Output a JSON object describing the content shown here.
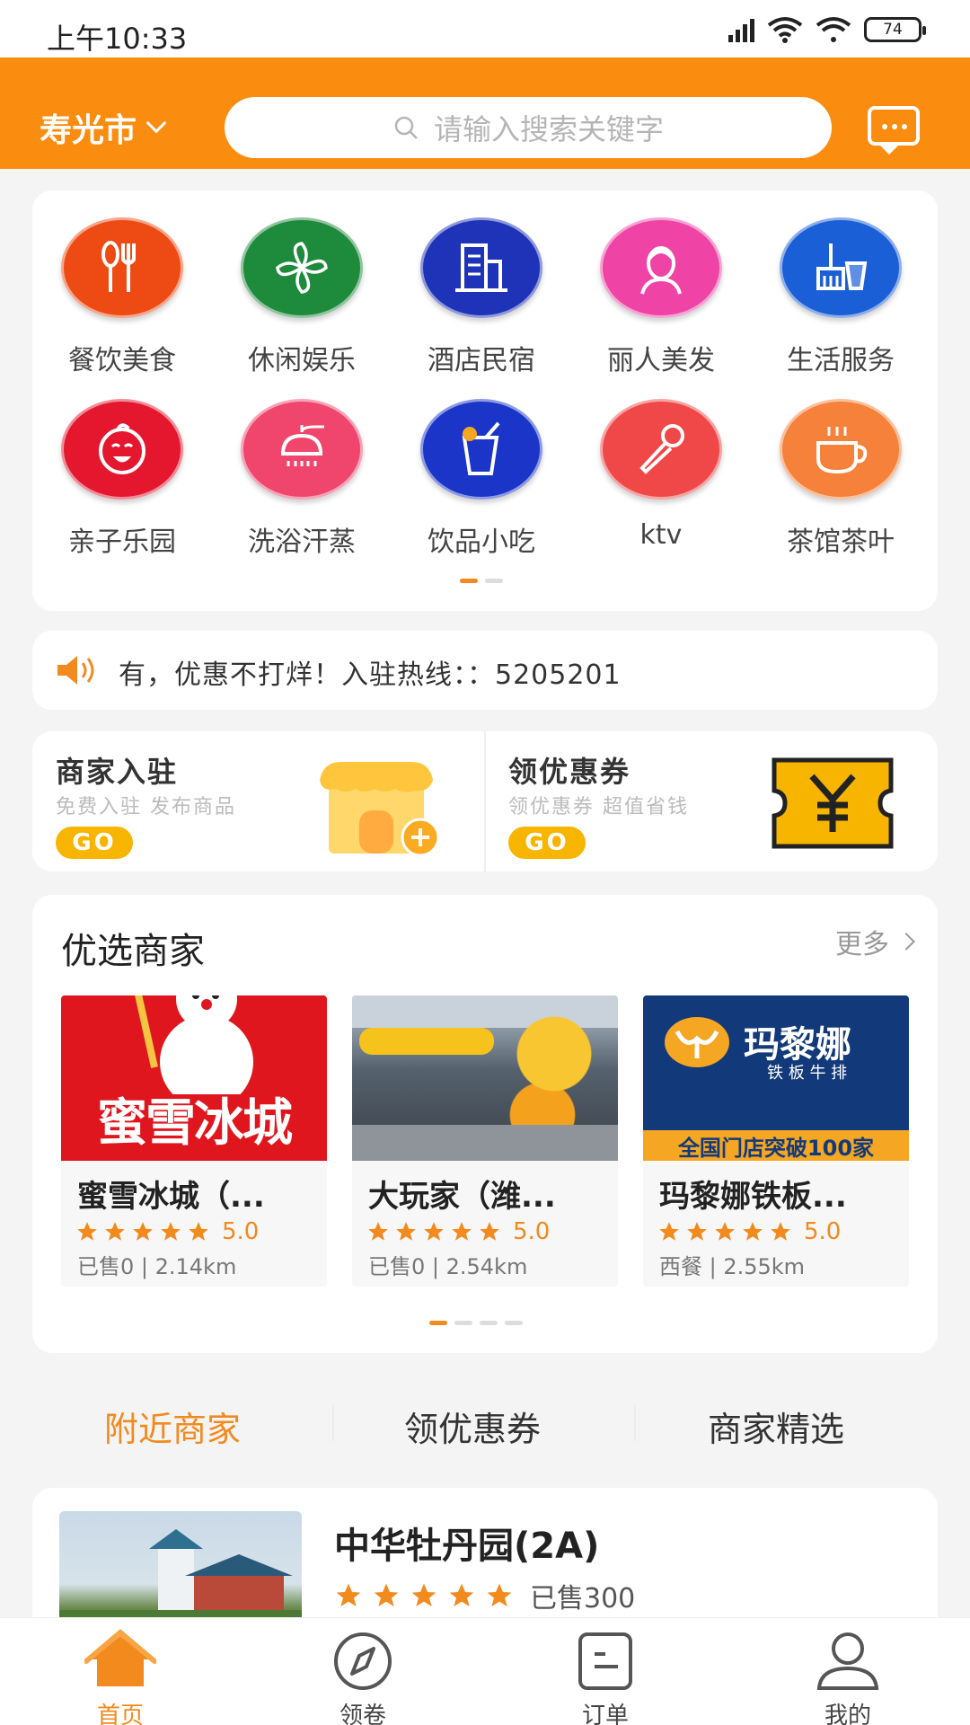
{
  "status_bar": {
    "time": "上午10:33",
    "battery": "74"
  },
  "header": {
    "city": "寿光市",
    "search_placeholder": "请输入搜索关键字"
  },
  "categories": [
    {
      "label": "餐饮美食",
      "icon": "utensils-icon",
      "color": "#ee4a14"
    },
    {
      "label": "休闲娱乐",
      "icon": "pinwheel-icon",
      "color": "#1e8a3c"
    },
    {
      "label": "酒店民宿",
      "icon": "building-icon",
      "color": "#1f33b8"
    },
    {
      "label": "丽人美发",
      "icon": "woman-icon",
      "color": "#ef44a6"
    },
    {
      "label": "生活服务",
      "icon": "cleaning-icon",
      "color": "#1b5fd6"
    },
    {
      "label": "亲子乐园",
      "icon": "baby-face-icon",
      "color": "#e4172f"
    },
    {
      "label": "洗浴汗蒸",
      "icon": "shower-icon",
      "color": "#f0466e"
    },
    {
      "label": "饮品小吃",
      "icon": "drink-icon",
      "color": "#1b35c8"
    },
    {
      "label": "ktv",
      "icon": "microphone-icon",
      "color": "#f04848"
    },
    {
      "label": "茶馆茶叶",
      "icon": "teacup-icon",
      "color": "#f5813a"
    }
  ],
  "notice": {
    "text": "有，优惠不打烊！入驻热线：：5205201"
  },
  "promos": [
    {
      "title": "商家入驻",
      "subtitle": "免费入驻  发布商品",
      "go": "GO"
    },
    {
      "title": "领优惠券",
      "subtitle": "领优惠券  超值省钱",
      "go": "GO"
    }
  ],
  "featured": {
    "title": "优选商家",
    "more": "更多",
    "shops": [
      {
        "name": "蜜雪冰城（...",
        "score": "5.0",
        "meta": "已售0  |  2.14km",
        "banner": "蜜雪冰城",
        "banner_color": "#e0161e"
      },
      {
        "name": "大玩家（潍...",
        "score": "5.0",
        "meta": "已售0  |  2.54km",
        "banner": "",
        "banner_color": "#6b7a86"
      },
      {
        "name": "玛黎娜铁板...",
        "score": "5.0",
        "meta": "西餐  |  2.55km",
        "banner": "玛黎娜",
        "banner_sub": "铁 板 牛 排",
        "banner_bottom": "全国门店突破100家",
        "banner_color": "#123a7a"
      }
    ]
  },
  "tabs": [
    "附近商家",
    "领优惠券",
    "商家精选"
  ],
  "list_item": {
    "title": "中华牡丹园(2A)",
    "sold": "已售300"
  },
  "bottom_nav": [
    {
      "label": "首页",
      "icon": "home-icon"
    },
    {
      "label": "领卷",
      "icon": "compass-icon"
    },
    {
      "label": "订单",
      "icon": "order-icon"
    },
    {
      "label": "我的",
      "icon": "user-icon"
    }
  ],
  "colors": {
    "accent": "#fa8d10",
    "star": "#f28a1e"
  }
}
